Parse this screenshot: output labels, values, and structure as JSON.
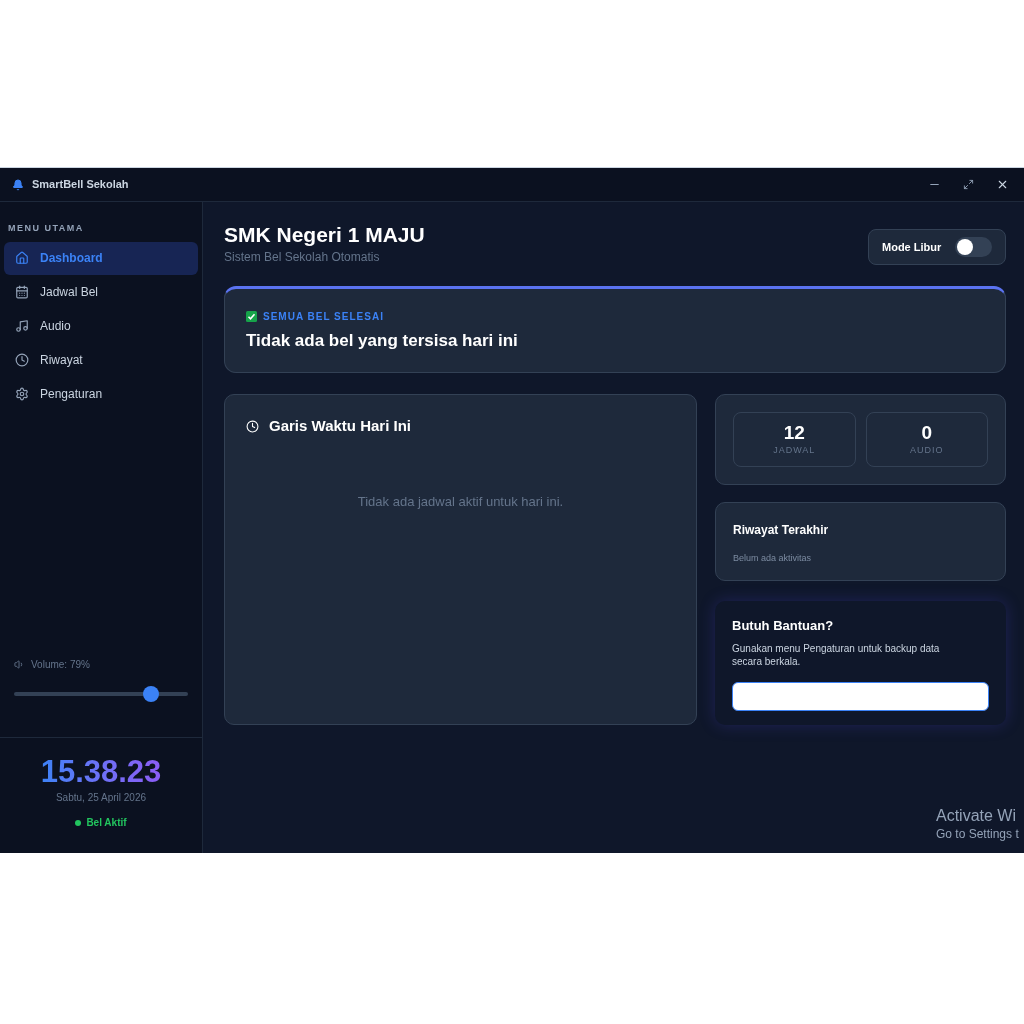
{
  "window": {
    "title": "SmartBell Sekolah"
  },
  "sidebar": {
    "section_title": "MENU UTAMA",
    "items": [
      {
        "label": "Dashboard",
        "selected": true
      },
      {
        "label": "Jadwal Bel",
        "selected": false
      },
      {
        "label": "Audio",
        "selected": false
      },
      {
        "label": "Riwayat",
        "selected": false
      },
      {
        "label": "Pengaturan",
        "selected": false
      }
    ],
    "volume": {
      "label": "Volume: 79%",
      "level": 0.79
    },
    "clock": {
      "time": "15.38.23",
      "date": "Sabtu, 25 April 2026",
      "status": "Bel Aktif",
      "active": true
    }
  },
  "header": {
    "title": "SMK Negeri 1 MAJU",
    "subtitle": "Sistem Bel Sekolah Otomatis",
    "holiday_toggle": {
      "label": "Mode Libur",
      "on": false
    }
  },
  "alert": {
    "eyebrow": "SEMUA BEL SELESAI",
    "message": "Tidak ada bel yang tersisa hari ini"
  },
  "timeline": {
    "title": "Garis Waktu Hari Ini",
    "empty_text": "Tidak ada jadwal aktif untuk hari ini."
  },
  "stats": [
    {
      "value": "12",
      "label": "JADWAL"
    },
    {
      "value": "0",
      "label": "AUDIO"
    }
  ],
  "history": {
    "title": "Riwayat Terakhir",
    "empty_text": "Belum ada aktivitas"
  },
  "help": {
    "title": "Butuh Bantuan?",
    "text": "Gunakan menu Pengaturan untuk backup data secara berkala."
  },
  "os_overlay": {
    "line_1": "Activate Wi",
    "line_2": "Go to Settings t"
  }
}
